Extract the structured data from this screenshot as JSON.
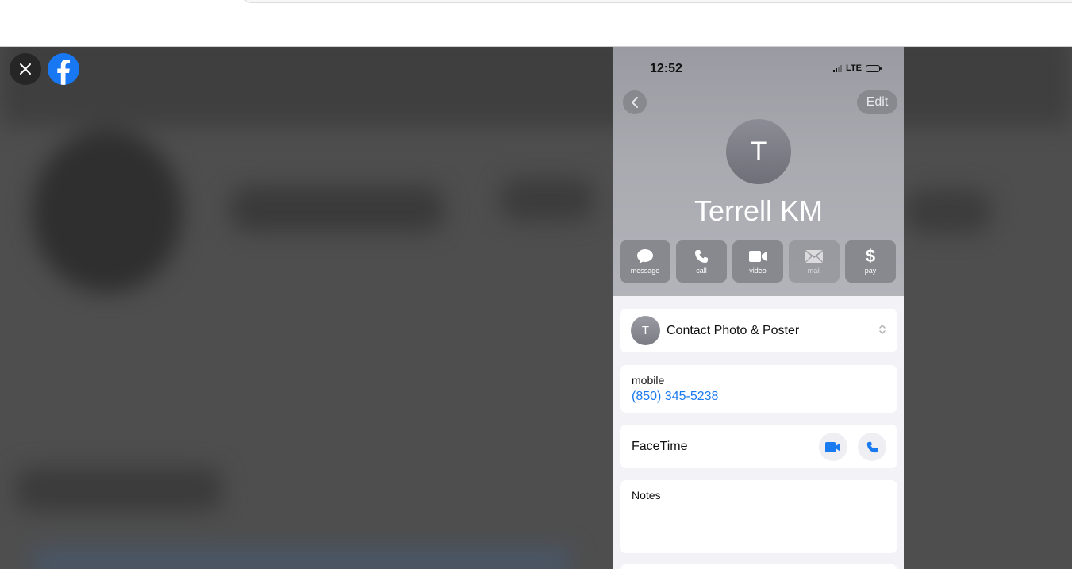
{
  "viewer": {
    "close_icon": "close-icon",
    "logo_icon": "facebook-logo-icon",
    "brand_color": "#1877f2"
  },
  "phone": {
    "status": {
      "time": "12:52",
      "network": "LTE"
    },
    "header": {
      "edit_label": "Edit",
      "avatar_initial": "T",
      "name": "Terrell KM"
    },
    "actions": [
      {
        "label": "message",
        "icon": "message-bubble-icon",
        "enabled": true
      },
      {
        "label": "call",
        "icon": "phone-icon",
        "enabled": true
      },
      {
        "label": "video",
        "icon": "video-camera-icon",
        "enabled": true
      },
      {
        "label": "mail",
        "icon": "envelope-icon",
        "enabled": false
      },
      {
        "label": "pay",
        "icon": "dollar-icon",
        "enabled": true
      }
    ],
    "photo_poster": {
      "initial": "T",
      "label": "Contact Photo & Poster"
    },
    "mobile": {
      "label": "mobile",
      "number": "(850) 345-5238"
    },
    "facetime": {
      "label": "FaceTime"
    },
    "notes": {
      "label": "Notes"
    },
    "accent_color": "#1a7af0"
  }
}
